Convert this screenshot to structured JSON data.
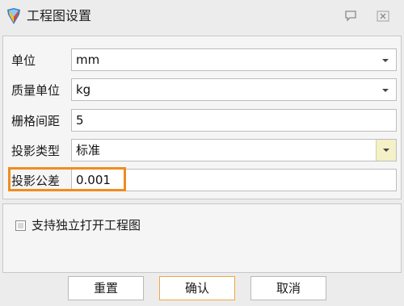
{
  "window": {
    "title": "工程图设置",
    "icon": "app-logo-icon",
    "controls": [
      "help-icon",
      "close-icon"
    ]
  },
  "form": {
    "unit": {
      "label": "单位",
      "value": "mm"
    },
    "mass_unit": {
      "label": "质量单位",
      "value": "kg"
    },
    "grid_spacing": {
      "label": "栅格间距",
      "value": "5"
    },
    "projection_type": {
      "label": "投影类型",
      "value": "标准"
    },
    "projection_tolerance": {
      "label": "投影公差",
      "value": "0.001"
    }
  },
  "options": {
    "independent_open": {
      "label": "支持独立打开工程图",
      "checked": false
    }
  },
  "buttons": {
    "reset": "重置",
    "confirm": "确认",
    "cancel": "取消"
  },
  "colors": {
    "highlight": "#f08c1e",
    "primary_border": "#f0a640"
  }
}
